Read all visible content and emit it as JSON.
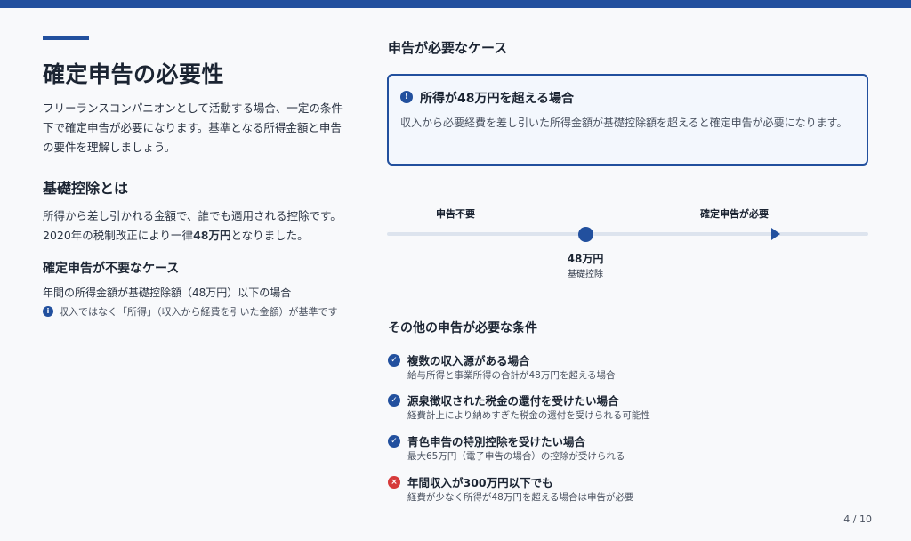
{
  "colors": {
    "accent": "#22509e",
    "error": "#d63a3a",
    "box_bg": "#f3f7fd"
  },
  "left": {
    "title": "確定申告の必要性",
    "intro": "フリーランスコンパニオンとして活動する場合、一定の条件下で確定申告が必要になります。基準となる所得金額と申告の要件を理解しましょう。",
    "basic": {
      "heading": "基礎控除とは",
      "text_pre": "所得から差し引かれる金額で、誰でも適用される控除です。2020年の税制改正により一律",
      "text_bold": "48万円",
      "text_post": "となりました。"
    },
    "not_needed": {
      "heading": "確定申告が不要なケース",
      "text": "年間の所得金額が基礎控除額（48万円）以下の場合",
      "note_icon": "info-icon",
      "note": "収入ではなく「所得」（収入から経費を引いた金額）が基準です"
    }
  },
  "right": {
    "heading": "申告が必要なケース",
    "case": {
      "icon": "exclamation-icon",
      "title": "所得が48万円を超える場合",
      "desc": "収入から必要経費を差し引いた所得金額が基礎控除額を超えると確定申告が必要になります。"
    },
    "timeline": {
      "left_label": "申告不要",
      "right_label": "確定申告が必要",
      "amount": "48万円",
      "amount_label": "基礎控除"
    },
    "other": {
      "heading": "その他の申告が必要な条件",
      "items": [
        {
          "icon": "check-icon",
          "title": "複数の収入源がある場合",
          "desc": "給与所得と事業所得の合計が48万円を超える場合"
        },
        {
          "icon": "check-icon",
          "title": "源泉徴収された税金の還付を受けたい場合",
          "desc": "経費計上により納めすぎた税金の還付を受けられる可能性"
        },
        {
          "icon": "check-icon",
          "title": "青色申告の特別控除を受けたい場合",
          "desc": "最大65万円（電子申告の場合）の控除が受けられる"
        },
        {
          "icon": "cross-icon",
          "title": "年間収入が300万円以下でも",
          "desc": "経費が少なく所得が48万円を超える場合は申告が必要"
        }
      ]
    }
  },
  "page_number": "4 / 10"
}
